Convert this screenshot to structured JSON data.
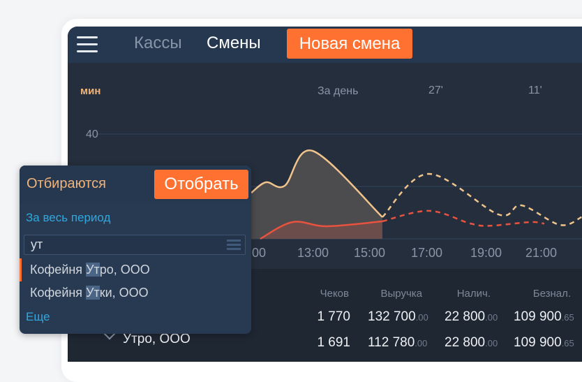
{
  "header": {
    "tabs": [
      "Кассы",
      "Смены"
    ],
    "new_shift_button": "Новая смена"
  },
  "chart_data": {
    "type": "line",
    "ylabel": "мин",
    "y_ticks": [
      "40"
    ],
    "x_ticks": [
      ":00",
      "13:00",
      "15:00",
      "17:00",
      "19:00",
      "21:00"
    ],
    "summary": {
      "label": "За день",
      "values": [
        "27'",
        "11'"
      ]
    },
    "series": [
      {
        "style": "solid-area",
        "color": "#f0c48c",
        "points": [
          [
            10.76,
            17.6
          ],
          [
            11.27,
            21.6
          ],
          [
            11.93,
            20.3
          ],
          [
            12.9,
            33.6
          ],
          [
            15.34,
            8.3
          ]
        ]
      },
      {
        "style": "dashed",
        "color": "#f0c48c",
        "points": [
          [
            15.34,
            8.3
          ],
          [
            16.95,
            24.8
          ],
          [
            19.4,
            9.3
          ],
          [
            20.2,
            12.8
          ],
          [
            21.55,
            5.3
          ],
          [
            22.3,
            8.3
          ]
        ]
      },
      {
        "style": "solid-area",
        "color": "#e8523e",
        "points": [
          [
            11.07,
            0
          ],
          [
            12.2,
            6.4
          ],
          [
            13.4,
            4.8
          ],
          [
            15.34,
            6.7
          ]
        ]
      },
      {
        "style": "dashed",
        "color": "#e8523e",
        "points": [
          [
            15.34,
            6.7
          ],
          [
            16.97,
            10.7
          ],
          [
            18.4,
            5.9
          ],
          [
            19.1,
            5
          ],
          [
            20.5,
            6.4
          ],
          [
            21,
            5.8
          ]
        ]
      }
    ]
  },
  "table": {
    "headers": [
      "Чеков",
      "Выручка",
      "Налич.",
      "Безнал."
    ],
    "rows": [
      {
        "label": "",
        "cells": [
          [
            "1 770",
            ""
          ],
          [
            "132 700",
            ".00"
          ],
          [
            "22 800",
            ".00"
          ],
          [
            "109 900",
            ".65"
          ]
        ]
      },
      {
        "label": "Утро, ООО",
        "cells": [
          [
            "1 691",
            ""
          ],
          [
            "112 780",
            ".00"
          ],
          [
            "22 800",
            ".00"
          ],
          [
            "109 900",
            ".65"
          ]
        ]
      }
    ]
  },
  "popup": {
    "title": "Отбираются",
    "apply_button": "Отобрать",
    "period_link": "За весь период",
    "search_value": "ут",
    "items": [
      {
        "match": "Ут",
        "pre": "Кофейня ",
        "post": "ро, ООО"
      },
      {
        "match": "Ут",
        "pre": "Кофейня ",
        "post": "ки, ООО"
      }
    ],
    "more_link": "Еще"
  },
  "colors": {
    "accent": "#ff7131",
    "link": "#2fa8e0",
    "title": "#f0b47a"
  }
}
